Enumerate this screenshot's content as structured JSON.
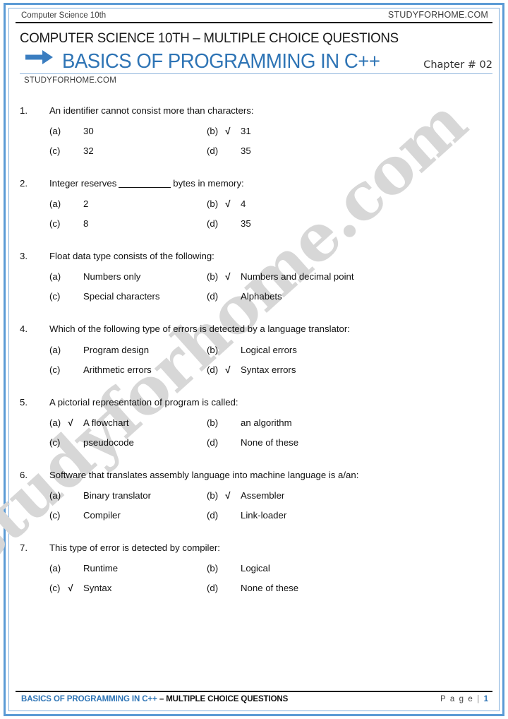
{
  "running_head": {
    "left": "Computer Science 10th",
    "right": "STUDYFORHOME.COM"
  },
  "title_block": {
    "subject_line": "COMPUTER SCIENCE 10TH – MULTIPLE CHOICE QUESTIONS",
    "arrow_icon": "arrow-right-icon",
    "chapter_title": "BASICS OF PROGRAMMING IN C++",
    "chapter_number": "Chapter # 02",
    "site_line": "STUDYFORHOME.COM"
  },
  "watermark": "studyforhome.com",
  "colors": {
    "accent_blue": "#2E74B5",
    "border_blue": "#5B9BD5",
    "rule_blue": "#8EB4DC",
    "watermark_gray": "#d7d7d7",
    "text_black": "#111111"
  },
  "tick_glyph": "√",
  "questions": [
    {
      "number": "1.",
      "text_before": "An identifier cannot consist more than characters:",
      "has_blank": false,
      "text_after": "",
      "options": [
        {
          "label": "(a)",
          "text": "30",
          "correct": false
        },
        {
          "label": "(b)",
          "text": "31",
          "correct": true
        },
        {
          "label": "(c)",
          "text": "32",
          "correct": false
        },
        {
          "label": "(d)",
          "text": "35",
          "correct": false
        }
      ]
    },
    {
      "number": "2.",
      "text_before": "Integer reserves",
      "has_blank": true,
      "text_after": "bytes in memory:",
      "options": [
        {
          "label": "(a)",
          "text": "2",
          "correct": false
        },
        {
          "label": "(b)",
          "text": "4",
          "correct": true
        },
        {
          "label": "(c)",
          "text": "8",
          "correct": false
        },
        {
          "label": "(d)",
          "text": "35",
          "correct": false
        }
      ]
    },
    {
      "number": "3.",
      "text_before": "Float data type consists of the following:",
      "has_blank": false,
      "text_after": "",
      "options": [
        {
          "label": "(a)",
          "text": "Numbers only",
          "correct": false
        },
        {
          "label": "(b)",
          "text": "Numbers and decimal point",
          "correct": true
        },
        {
          "label": "(c)",
          "text": "Special characters",
          "correct": false
        },
        {
          "label": "(d)",
          "text": "Alphabets",
          "correct": false
        }
      ]
    },
    {
      "number": "4.",
      "text_before": "Which of the following type of errors is detected by a language translator:",
      "has_blank": false,
      "text_after": "",
      "options": [
        {
          "label": "(a)",
          "text": "Program design",
          "correct": false
        },
        {
          "label": "(b)",
          "text": "Logical errors",
          "correct": false
        },
        {
          "label": "(c)",
          "text": "Arithmetic errors",
          "correct": false
        },
        {
          "label": "(d)",
          "text": "Syntax errors",
          "correct": true
        }
      ]
    },
    {
      "number": "5.",
      "text_before": "A pictorial representation of program is called:",
      "has_blank": false,
      "text_after": "",
      "options": [
        {
          "label": "(a)",
          "text": "A flowchart",
          "correct": true
        },
        {
          "label": "(b)",
          "text": "an algorithm",
          "correct": false
        },
        {
          "label": "(c)",
          "text": "pseudocode",
          "correct": false
        },
        {
          "label": "(d)",
          "text": "None of these",
          "correct": false
        }
      ]
    },
    {
      "number": "6.",
      "text_before": "Software that translates assembly language into machine language is a/an:",
      "has_blank": false,
      "text_after": "",
      "options": [
        {
          "label": "(a)",
          "text": "Binary translator",
          "correct": false
        },
        {
          "label": "(b)",
          "text": "Assembler",
          "correct": true
        },
        {
          "label": "(c)",
          "text": "Compiler",
          "correct": false
        },
        {
          "label": "(d)",
          "text": "Link-loader",
          "correct": false
        }
      ]
    },
    {
      "number": "7.",
      "text_before": "This type of error is detected by compiler:",
      "has_blank": false,
      "text_after": "",
      "options": [
        {
          "label": "(a)",
          "text": "Runtime",
          "correct": false
        },
        {
          "label": "(b)",
          "text": "Logical",
          "correct": false
        },
        {
          "label": "(c)",
          "text": "Syntax",
          "correct": true
        },
        {
          "label": "(d)",
          "text": "None of these",
          "correct": false
        }
      ]
    }
  ],
  "footer": {
    "title_blue": "BASICS OF PROGRAMMING IN C++",
    "title_rest": " – MULTIPLE CHOICE QUESTIONS",
    "page_label": "P a g e",
    "page_separator": "|",
    "page_number": "1"
  }
}
